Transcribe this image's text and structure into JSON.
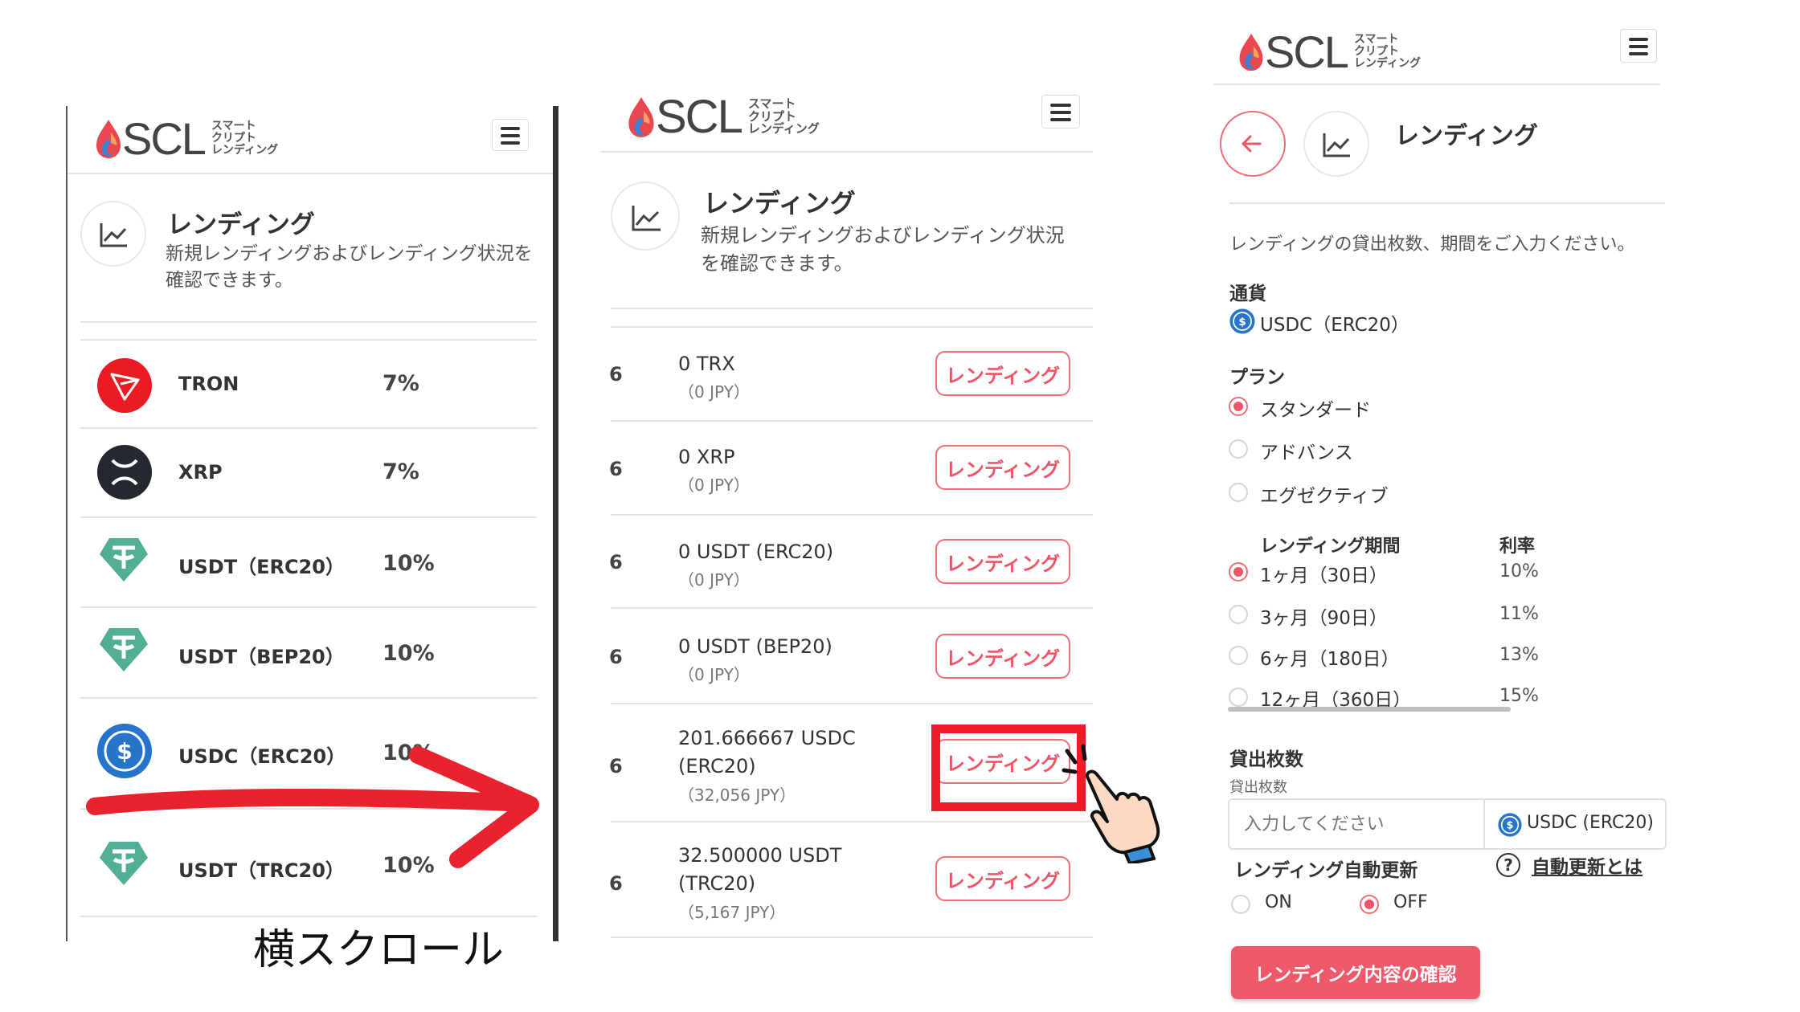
{
  "brand": {
    "name": "SCL",
    "subtitle_lines": [
      "スマート",
      "クリプト",
      "レンディング"
    ],
    "colors": {
      "accent": "#ee5566",
      "logo_red": "#e9474f",
      "logo_blue": "#3a82d6",
      "divider": "#e4e4e4",
      "highlight_box": "#ee1c2a",
      "arrow": "#e8232e"
    }
  },
  "panel1": {
    "title": "レンディング",
    "description": "新規レンディングおよびレンディング状況を確認できます。",
    "items": [
      {
        "name": "TRON",
        "rate": "7%",
        "icon": "tron-icon"
      },
      {
        "name": "XRP",
        "rate": "7%",
        "icon": "xrp-icon"
      },
      {
        "name": "USDT（ERC20）",
        "rate": "10%",
        "icon": "tether-icon"
      },
      {
        "name": "USDT（BEP20）",
        "rate": "10%",
        "icon": "tether-icon"
      },
      {
        "name": "USDC（ERC20）",
        "rate": "10%",
        "icon": "usdc-icon"
      },
      {
        "name": "USDT（TRC20）",
        "rate": "10%",
        "icon": "tether-icon"
      }
    ]
  },
  "annotation": {
    "scroll_text": "横スクロール"
  },
  "panel2": {
    "title": "レンディング",
    "description": "新規レンディングおよびレンディング状況を確認できます。",
    "clipped_rate": "6",
    "button_label": "レンディング",
    "rows": [
      {
        "amount": "0 TRX",
        "jpy": "（0 JPY）"
      },
      {
        "amount": "0 XRP",
        "jpy": "（0 JPY）"
      },
      {
        "amount": "0 USDT (ERC20)",
        "jpy": "（0 JPY）"
      },
      {
        "amount": "0 USDT (BEP20)",
        "jpy": "（0 JPY）"
      },
      {
        "amount": "201.666667 USDC\n(ERC20)",
        "jpy": "（32,056 JPY）"
      },
      {
        "amount": "32.500000 USDT\n(TRC20)",
        "jpy": "（5,167 JPY）"
      }
    ]
  },
  "panel3": {
    "title": "レンディング",
    "instruction": "レンディングの貸出枚数、期間をご入力ください。",
    "currency_label": "通貨",
    "currency_value": "USDC（ERC20）",
    "plan_label": "プラン",
    "plans": [
      {
        "label": "スタンダード",
        "selected": true
      },
      {
        "label": "アドバンス",
        "selected": false
      },
      {
        "label": "エグゼクティブ",
        "selected": false
      }
    ],
    "period_header": "レンディング期間",
    "rate_header": "利率",
    "periods": [
      {
        "label": "1ヶ月（30日）",
        "rate": "10%",
        "selected": true
      },
      {
        "label": "3ヶ月（90日）",
        "rate": "11%",
        "selected": false
      },
      {
        "label": "6ヶ月（180日）",
        "rate": "13%",
        "selected": false
      },
      {
        "label": "12ヶ月（360日）",
        "rate": "15%",
        "selected": false
      }
    ],
    "amount_label": "貸出枚数",
    "amount_sublabel": "貸出枚数",
    "amount_placeholder": "入力してください",
    "amount_unit": "USDC (ERC20)",
    "auto_renew_label": "レンディング自動更新",
    "auto_renew_help": "自動更新とは",
    "auto_renew_on": "ON",
    "auto_renew_off": "OFF",
    "auto_renew_selected": "OFF",
    "confirm_button": "レンディング内容の確認"
  }
}
